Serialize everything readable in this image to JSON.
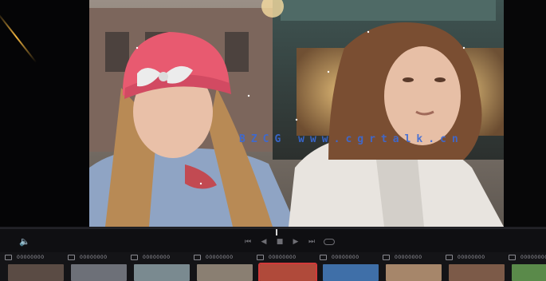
{
  "watermark": "BZCG www.cgrtalk.cn",
  "viewer": {
    "left_streak_color": "#f3b640",
    "subject_left": "girl in pink knit hat with white bow",
    "subject_right": "girl in white winter jacket"
  },
  "transport": {
    "volume_icon": "speaker-icon",
    "controls": [
      "previous-clip-icon",
      "step-back-icon",
      "stop-icon",
      "step-forward-icon",
      "next-clip-icon",
      "loop-icon"
    ]
  },
  "clips": [
    {
      "label": "00000000",
      "thumb_color": "#5a4b44"
    },
    {
      "label": "00000000",
      "thumb_color": "#6d7078"
    },
    {
      "label": "00000000",
      "thumb_color": "#7a8a90"
    },
    {
      "label": "00000000",
      "thumb_color": "#8a7f72"
    },
    {
      "label": "00000000",
      "thumb_color": "#b04a3a"
    },
    {
      "label": "00000000",
      "thumb_color": "#3f6fa8"
    },
    {
      "label": "00000000",
      "thumb_color": "#a6866a"
    },
    {
      "label": "00000000",
      "thumb_color": "#7c5a48"
    },
    {
      "label": "00000000",
      "thumb_color": "#5a8a4a"
    }
  ],
  "selected_clip_index": 4,
  "accent_color": "#d23a3a"
}
